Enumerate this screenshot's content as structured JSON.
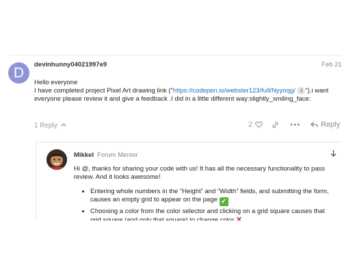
{
  "post": {
    "avatar_letter": "D",
    "avatar_color": "#8f94d6",
    "username": "devinhunny04021997e9",
    "date": "Feb 21",
    "greeting": "Hello everyone",
    "body_before_link": "I have completed project Pixel Art drawing link (“",
    "link_text": "https://codepen.io/webster123/full/Nyyoqg/",
    "link_count": "4",
    "body_after_link": "”).i want everyone please review it and give a feedback .I did in a little different way:slightly_smiling_face:",
    "replies_label": "1 Reply",
    "likes_count": "2",
    "reply_button": "Reply"
  },
  "reply": {
    "username": "Mikkel",
    "title": "Forum Mentor",
    "intro": "Hi @, thanks for sharing your code with us! It has all the necessary functionality to pass review. And it looks awesome!",
    "bullets": [
      "Entering whole numbers in the “Height” and “Width” fields, and submitting the form, causes an empty grid to appear on the page",
      "Choosing a color from the color selector and clicking on a grid square causes that grid square (and only that square) to change color"
    ]
  },
  "colors": {
    "link": "#1a6ec2",
    "check": "#5bb33a",
    "cross": "#d0253a"
  }
}
